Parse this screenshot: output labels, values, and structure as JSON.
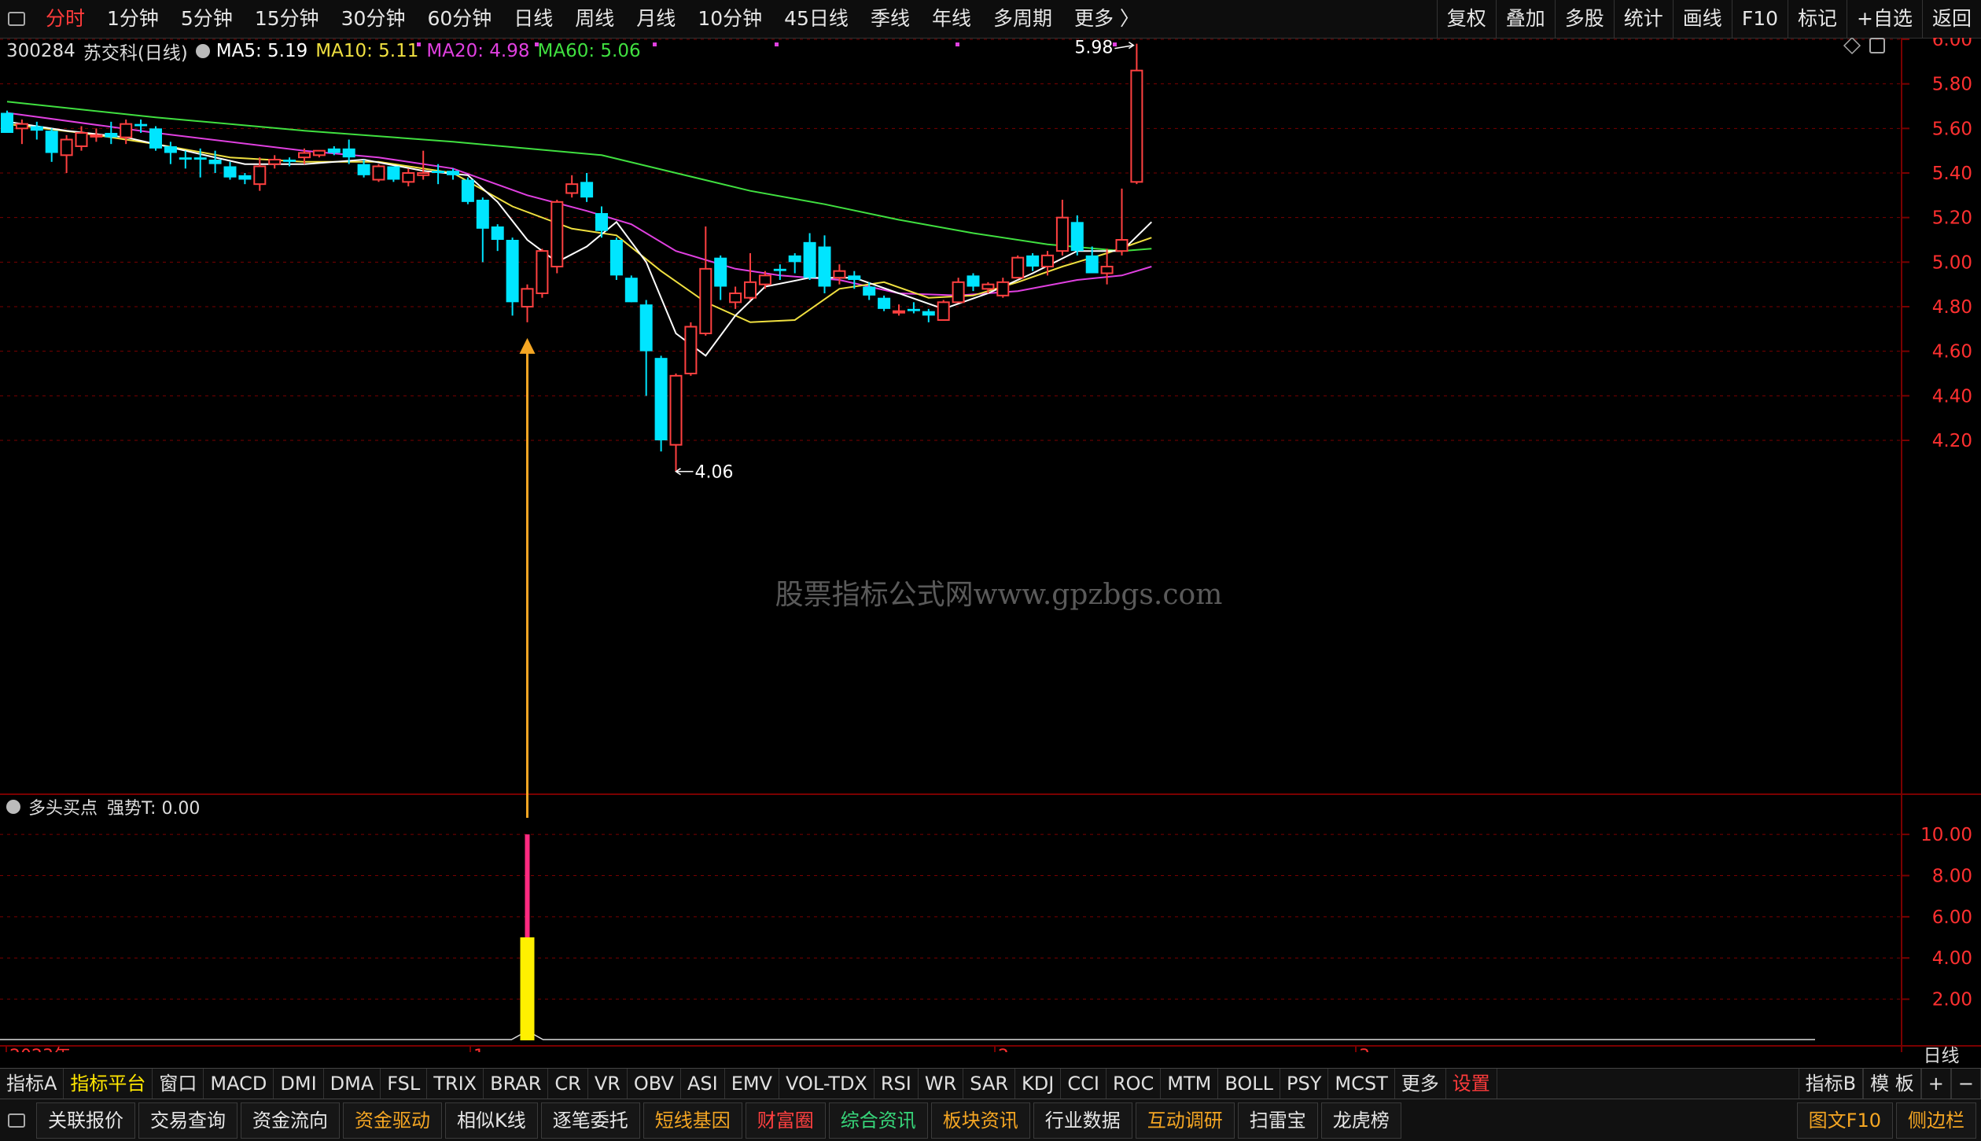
{
  "topbar": {
    "periods": [
      "分时",
      "1分钟",
      "5分钟",
      "15分钟",
      "30分钟",
      "60分钟",
      "日线",
      "周线",
      "月线",
      "10分钟",
      "45日线",
      "季线",
      "年线",
      "多周期",
      "更多 〉"
    ],
    "active_index": 0,
    "right_buttons": [
      "复权",
      "叠加",
      "多股",
      "统计",
      "画线",
      "F10",
      "标记",
      "+自选",
      "返回"
    ]
  },
  "info": {
    "code": "300284",
    "name": "苏交科(日线)",
    "ma5": "MA5: 5.19",
    "ma10": "MA10: 5.11",
    "ma20": "MA20: 4.98",
    "ma60": "MA60: 5.06"
  },
  "colors": {
    "ma5": "#ffffff",
    "ma10": "#f0e040",
    "ma20": "#e040e0",
    "ma60": "#40e040",
    "up": "#ff4040",
    "down": "#00e5ff",
    "grid": "#7a0000",
    "axis_text": "#ff3030"
  },
  "chart_data": {
    "type": "candlestick",
    "title": "",
    "ylim": [
      4.0,
      6.05
    ],
    "yticks": [
      "6.00",
      "5.80",
      "5.60",
      "5.40",
      "5.20",
      "5.00",
      "4.80",
      "4.60",
      "4.40",
      "4.20"
    ],
    "high_label": "5.98",
    "low_label": "4.06",
    "watermark": "股票指标公式网www.gpzbgs.com",
    "candles": [
      [
        5.67,
        5.58,
        5.68,
        5.58
      ],
      [
        5.6,
        5.62,
        5.64,
        5.53
      ],
      [
        5.61,
        5.59,
        5.63,
        5.55
      ],
      [
        5.59,
        5.49,
        5.6,
        5.45
      ],
      [
        5.48,
        5.55,
        5.57,
        5.4
      ],
      [
        5.52,
        5.58,
        5.61,
        5.5
      ],
      [
        5.57,
        5.57,
        5.6,
        5.54
      ],
      [
        5.58,
        5.56,
        5.63,
        5.53
      ],
      [
        5.56,
        5.62,
        5.64,
        5.53
      ],
      [
        5.62,
        5.61,
        5.64,
        5.58
      ],
      [
        5.6,
        5.51,
        5.61,
        5.5
      ],
      [
        5.52,
        5.49,
        5.54,
        5.44
      ],
      [
        5.47,
        5.46,
        5.5,
        5.42
      ],
      [
        5.47,
        5.46,
        5.51,
        5.38
      ],
      [
        5.46,
        5.44,
        5.5,
        5.4
      ],
      [
        5.43,
        5.38,
        5.45,
        5.37
      ],
      [
        5.39,
        5.37,
        5.4,
        5.35
      ],
      [
        5.35,
        5.43,
        5.47,
        5.32
      ],
      [
        5.44,
        5.46,
        5.48,
        5.42
      ],
      [
        5.46,
        5.45,
        5.47,
        5.43
      ],
      [
        5.47,
        5.49,
        5.51,
        5.44
      ],
      [
        5.48,
        5.5,
        5.5,
        5.47
      ],
      [
        5.51,
        5.49,
        5.52,
        5.48
      ],
      [
        5.51,
        5.47,
        5.55,
        5.44
      ],
      [
        5.44,
        5.39,
        5.46,
        5.38
      ],
      [
        5.37,
        5.43,
        5.44,
        5.36
      ],
      [
        5.43,
        5.37,
        5.43,
        5.36
      ],
      [
        5.36,
        5.4,
        5.42,
        5.34
      ],
      [
        5.39,
        5.4,
        5.5,
        5.37
      ],
      [
        5.41,
        5.4,
        5.44,
        5.35
      ],
      [
        5.41,
        5.39,
        5.42,
        5.37
      ],
      [
        5.37,
        5.27,
        5.38,
        5.26
      ],
      [
        5.28,
        5.15,
        5.29,
        5.0
      ],
      [
        5.16,
        5.1,
        5.17,
        5.05
      ],
      [
        5.1,
        4.82,
        5.11,
        4.76
      ],
      [
        4.8,
        4.88,
        4.9,
        4.73
      ],
      [
        4.86,
        5.05,
        5.06,
        4.84
      ],
      [
        4.98,
        5.27,
        5.28,
        4.95
      ],
      [
        5.31,
        5.35,
        5.39,
        5.29
      ],
      [
        5.36,
        5.29,
        5.4,
        5.27
      ],
      [
        5.22,
        5.14,
        5.25,
        5.11
      ],
      [
        5.1,
        4.94,
        5.11,
        4.92
      ],
      [
        4.93,
        4.82,
        4.94,
        4.82
      ],
      [
        4.81,
        4.6,
        4.83,
        4.4
      ],
      [
        4.57,
        4.2,
        4.58,
        4.15
      ],
      [
        4.18,
        4.49,
        4.5,
        4.06
      ],
      [
        4.5,
        4.71,
        4.73,
        4.49
      ],
      [
        4.68,
        4.97,
        5.16,
        4.67
      ],
      [
        5.02,
        4.89,
        5.03,
        4.83
      ],
      [
        4.82,
        4.86,
        4.89,
        4.79
      ],
      [
        4.84,
        4.91,
        5.04,
        4.83
      ],
      [
        4.9,
        4.94,
        4.96,
        4.88
      ],
      [
        4.97,
        4.96,
        4.99,
        4.92
      ],
      [
        5.03,
        5.0,
        5.04,
        4.95
      ],
      [
        5.09,
        4.93,
        5.13,
        4.92
      ],
      [
        5.07,
        4.89,
        5.12,
        4.86
      ],
      [
        4.93,
        4.96,
        4.99,
        4.9
      ],
      [
        4.94,
        4.92,
        4.96,
        4.88
      ],
      [
        4.89,
        4.85,
        4.91,
        4.83
      ],
      [
        4.84,
        4.79,
        4.85,
        4.78
      ],
      [
        4.78,
        4.78,
        4.81,
        4.76
      ],
      [
        4.79,
        4.78,
        4.82,
        4.77
      ],
      [
        4.78,
        4.76,
        4.79,
        4.73
      ],
      [
        4.74,
        4.82,
        4.83,
        4.74
      ],
      [
        4.82,
        4.91,
        4.93,
        4.82
      ],
      [
        4.94,
        4.89,
        4.95,
        4.87
      ],
      [
        4.88,
        4.9,
        4.91,
        4.86
      ],
      [
        4.85,
        4.91,
        4.93,
        4.84
      ],
      [
        4.93,
        5.02,
        5.03,
        4.93
      ],
      [
        5.03,
        4.98,
        5.04,
        4.96
      ],
      [
        4.98,
        5.03,
        5.05,
        4.94
      ],
      [
        5.05,
        5.2,
        5.28,
        5.03
      ],
      [
        5.18,
        5.05,
        5.21,
        5.03
      ],
      [
        5.03,
        4.95,
        5.07,
        4.95
      ],
      [
        4.95,
        4.98,
        5.06,
        4.9
      ],
      [
        5.05,
        5.1,
        5.33,
        5.03
      ],
      [
        5.36,
        5.86,
        5.98,
        5.35
      ]
    ],
    "ma5": [
      [
        0,
        5.63
      ],
      [
        4,
        5.59
      ],
      [
        8,
        5.56
      ],
      [
        12,
        5.5
      ],
      [
        16,
        5.44
      ],
      [
        20,
        5.44
      ],
      [
        24,
        5.46
      ],
      [
        28,
        5.41
      ],
      [
        31,
        5.39
      ],
      [
        33,
        5.27
      ],
      [
        35,
        5.1
      ],
      [
        37,
        5.0
      ],
      [
        39,
        5.07
      ],
      [
        41,
        5.18
      ],
      [
        43,
        5.0
      ],
      [
        45,
        4.68
      ],
      [
        47,
        4.58
      ],
      [
        49,
        4.76
      ],
      [
        51,
        4.89
      ],
      [
        54,
        4.93
      ],
      [
        57,
        4.93
      ],
      [
        60,
        4.86
      ],
      [
        63,
        4.79
      ],
      [
        66,
        4.86
      ],
      [
        69,
        4.95
      ],
      [
        72,
        5.05
      ],
      [
        75,
        5.05
      ],
      [
        77,
        5.18
      ]
    ],
    "ma10": [
      [
        0,
        5.62
      ],
      [
        5,
        5.58
      ],
      [
        10,
        5.53
      ],
      [
        15,
        5.47
      ],
      [
        20,
        5.45
      ],
      [
        25,
        5.45
      ],
      [
        30,
        5.4
      ],
      [
        34,
        5.25
      ],
      [
        38,
        5.15
      ],
      [
        41,
        5.12
      ],
      [
        44,
        4.96
      ],
      [
        47,
        4.82
      ],
      [
        50,
        4.73
      ],
      [
        53,
        4.74
      ],
      [
        56,
        4.88
      ],
      [
        59,
        4.91
      ],
      [
        62,
        4.84
      ],
      [
        65,
        4.85
      ],
      [
        68,
        4.91
      ],
      [
        71,
        4.98
      ],
      [
        74,
        5.04
      ],
      [
        77,
        5.11
      ]
    ],
    "ma20": [
      [
        0,
        5.67
      ],
      [
        10,
        5.58
      ],
      [
        20,
        5.5
      ],
      [
        25,
        5.47
      ],
      [
        30,
        5.42
      ],
      [
        35,
        5.3
      ],
      [
        39,
        5.23
      ],
      [
        42,
        5.17
      ],
      [
        45,
        5.05
      ],
      [
        49,
        4.97
      ],
      [
        52,
        4.94
      ],
      [
        56,
        4.92
      ],
      [
        60,
        4.86
      ],
      [
        64,
        4.85
      ],
      [
        68,
        4.87
      ],
      [
        72,
        4.92
      ],
      [
        75,
        4.94
      ],
      [
        77,
        4.98
      ]
    ],
    "ma60": [
      [
        0,
        5.72
      ],
      [
        10,
        5.65
      ],
      [
        20,
        5.59
      ],
      [
        30,
        5.54
      ],
      [
        40,
        5.48
      ],
      [
        45,
        5.4
      ],
      [
        50,
        5.32
      ],
      [
        55,
        5.26
      ],
      [
        60,
        5.19
      ],
      [
        65,
        5.13
      ],
      [
        70,
        5.08
      ],
      [
        75,
        5.05
      ],
      [
        77,
        5.06
      ]
    ],
    "sub": {
      "label": "多头买点",
      "readout": "强势T: 0.00",
      "ylim": [
        0,
        10.5
      ],
      "yticks": [
        "10.00",
        "8.00",
        "6.00",
        "4.00",
        "2.00"
      ],
      "signal_index": 35,
      "signal_magenta": 10,
      "signal_yellow": 5
    },
    "time_labels": [
      "2023年",
      "1",
      "2",
      "3"
    ]
  },
  "indicator_tabs": [
    "指标A",
    "指标平台",
    "窗口",
    "MACD",
    "DMI",
    "DMA",
    "FSL",
    "TRIX",
    "BRAR",
    "CR",
    "VR",
    "OBV",
    "ASI",
    "EMV",
    "VOL-TDX",
    "RSI",
    "WR",
    "SAR",
    "KDJ",
    "CCI",
    "ROC",
    "MTM",
    "BOLL",
    "PSY",
    "MCST",
    "更多",
    "设置"
  ],
  "indicator_right": [
    "指标B",
    "模 板",
    "+",
    "−"
  ],
  "time_period_label": "日线",
  "bottom_buttons": [
    {
      "label": "关联报价",
      "color": "white"
    },
    {
      "label": "交易查询",
      "color": "white"
    },
    {
      "label": "资金流向",
      "color": "white"
    },
    {
      "label": "资金驱动",
      "color": "orange"
    },
    {
      "label": "相似K线",
      "color": "white"
    },
    {
      "label": "逐笔委托",
      "color": "white"
    },
    {
      "label": "短线基因",
      "color": "orange"
    },
    {
      "label": "财富圈",
      "color": "red"
    },
    {
      "label": "综合资讯",
      "color": "green"
    },
    {
      "label": "板块资讯",
      "color": "orange"
    },
    {
      "label": "行业数据",
      "color": "white"
    },
    {
      "label": "互动调研",
      "color": "orange"
    },
    {
      "label": "扫雷宝",
      "color": "white"
    },
    {
      "label": "龙虎榜",
      "color": "white"
    }
  ],
  "bottom_right": [
    "图文F10",
    "侧边栏"
  ]
}
